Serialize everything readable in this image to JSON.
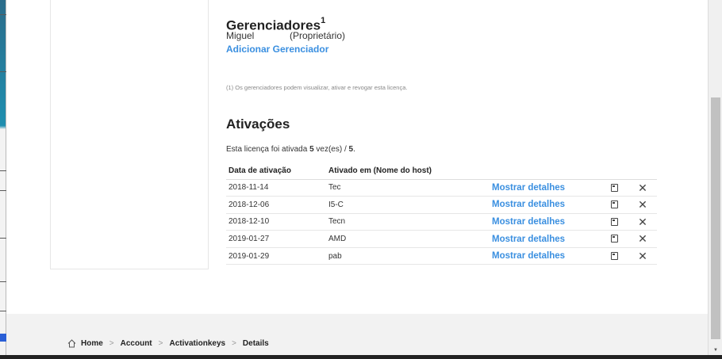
{
  "managers": {
    "title": "Gerenciadores",
    "title_sup": "1",
    "manager_name": "Miguel",
    "manager_role": "(Proprietário)",
    "add_link": "Adicionar Gerenciador",
    "footnote": "(1) Os gerenciadores podem visualizar, ativar e revogar esta licença."
  },
  "activations": {
    "title": "Ativações",
    "status_prefix": "Esta licença foi ativada ",
    "count": "5",
    "status_mid": " vez(es) / ",
    "max": "5",
    "status_suffix": ".",
    "columns": [
      "Data de ativação",
      "Ativado em (Nome do host)"
    ],
    "rows": [
      {
        "date": "2018-11-14",
        "host": "Tec",
        "details": "Mostrar detalhes"
      },
      {
        "date": "2018-12-06",
        "host": "I5-C",
        "details": "Mostrar detalhes"
      },
      {
        "date": "2018-12-10",
        "host": "Tecn",
        "details": "Mostrar detalhes"
      },
      {
        "date": "2019-01-27",
        "host": "AMD",
        "details": "Mostrar detalhes"
      },
      {
        "date": "2019-01-29",
        "host": "pab",
        "details": "Mostrar detalhes"
      }
    ],
    "row_icons": [
      "document-icon",
      "close-icon"
    ]
  },
  "breadcrumb": {
    "home_icon": "home-icon",
    "items": [
      "Home",
      "Account",
      "Activationkeys",
      "Details"
    ]
  },
  "colors": {
    "link": "#3a8fe0",
    "footer_bg": "#f2f2f2"
  }
}
